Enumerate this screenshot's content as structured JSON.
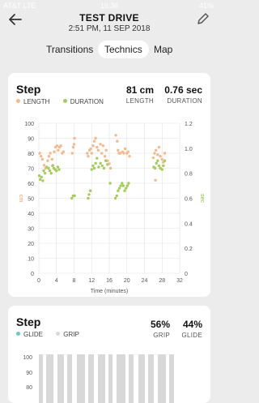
{
  "status": {
    "carrier": "AT&T LTE",
    "time": "16:36",
    "battery": "41%"
  },
  "header": {
    "title": "TEST DRIVE",
    "subtitle": "2:51 PM, 11 SEP 2018"
  },
  "tabs": [
    {
      "label": "Transitions",
      "active": false
    },
    {
      "label": "Technics",
      "active": true
    },
    {
      "label": "Map",
      "active": false
    }
  ],
  "step_card": {
    "title": "Step",
    "legend": [
      {
        "label": "LENGTH",
        "color": "#f5b98d"
      },
      {
        "label": "DURATION",
        "color": "#a6cc5a"
      }
    ],
    "stats": [
      {
        "value": "81 cm",
        "label": "LENGTH"
      },
      {
        "value": "0.76 sec",
        "label": "DURATION"
      }
    ]
  },
  "chart_data": {
    "type": "scatter",
    "xlabel": "Time (minutes)",
    "y_left_label": "cm",
    "y_right_label": "sec",
    "x_ticks": [
      0,
      4,
      8,
      12,
      16,
      20,
      24,
      28,
      32
    ],
    "y_left_ticks": [
      0,
      10,
      20,
      30,
      40,
      50,
      60,
      70,
      80,
      90,
      100
    ],
    "y_right_ticks": [
      "0",
      "0.2",
      "0.4",
      "0.6",
      "0.8",
      "1.0",
      "1.2"
    ],
    "xlim": [
      0,
      32
    ],
    "ylim_left": [
      0,
      100
    ],
    "ylim_right": [
      0,
      1.2
    ],
    "grid": true,
    "series": [
      {
        "name": "LENGTH",
        "axis": "left",
        "color": "#f5b98d",
        "points": [
          [
            0.2,
            80
          ],
          [
            0.5,
            78
          ],
          [
            0.8,
            76
          ],
          [
            1.2,
            72
          ],
          [
            1.5,
            70
          ],
          [
            2,
            75
          ],
          [
            2.3,
            78
          ],
          [
            2.6,
            80
          ],
          [
            3,
            76
          ],
          [
            3.2,
            72
          ],
          [
            3.5,
            81
          ],
          [
            3.8,
            84
          ],
          [
            4.1,
            85
          ],
          [
            4.4,
            82
          ],
          [
            4.7,
            84
          ],
          [
            5,
            85
          ],
          [
            5.3,
            80
          ],
          [
            5.6,
            81
          ],
          [
            7.6,
            80
          ],
          [
            7.8,
            84
          ],
          [
            8,
            86
          ],
          [
            8.1,
            90
          ],
          [
            11,
            80
          ],
          [
            11.2,
            78
          ],
          [
            11.5,
            82
          ],
          [
            11.8,
            83
          ],
          [
            12,
            80
          ],
          [
            12.3,
            85
          ],
          [
            12.6,
            88
          ],
          [
            12.9,
            90
          ],
          [
            13.2,
            84
          ],
          [
            13.5,
            82
          ],
          [
            14,
            86
          ],
          [
            14.3,
            80
          ],
          [
            14.6,
            85
          ],
          [
            15,
            78
          ],
          [
            15.3,
            82
          ],
          [
            15.6,
            75
          ],
          [
            16,
            73
          ],
          [
            16.3,
            70
          ],
          [
            17.5,
            92
          ],
          [
            17.8,
            88
          ],
          [
            18,
            82
          ],
          [
            18.2,
            80
          ],
          [
            18.5,
            80
          ],
          [
            19,
            81
          ],
          [
            19.3,
            80
          ],
          [
            19.6,
            83
          ],
          [
            20,
            80
          ],
          [
            20.3,
            81
          ],
          [
            20.6,
            78
          ],
          [
            26,
            77
          ],
          [
            26.3,
            80
          ],
          [
            26.6,
            82
          ],
          [
            27,
            79
          ],
          [
            27.3,
            84
          ],
          [
            27.6,
            78
          ],
          [
            28,
            76
          ],
          [
            28.3,
            74
          ],
          [
            28.6,
            80
          ],
          [
            26.5,
            62
          ]
        ]
      },
      {
        "name": "DURATION",
        "axis": "right",
        "color": "#a6cc5a",
        "points": [
          [
            0.1,
            0.78
          ],
          [
            0.3,
            0.75
          ],
          [
            0.6,
            0.77
          ],
          [
            0.9,
            0.74
          ],
          [
            1.1,
            0.82
          ],
          [
            1.4,
            0.8
          ],
          [
            1.8,
            0.85
          ],
          [
            2.2,
            0.84
          ],
          [
            2.5,
            0.82
          ],
          [
            2.8,
            0.8
          ],
          [
            3.1,
            0.86
          ],
          [
            3.4,
            0.84
          ],
          [
            3.7,
            0.83
          ],
          [
            4,
            0.82
          ],
          [
            4.3,
            0.85
          ],
          [
            4.6,
            0.83
          ],
          [
            7.5,
            0.6
          ],
          [
            7.8,
            0.62
          ],
          [
            8.1,
            0.62
          ],
          [
            11.2,
            0.6
          ],
          [
            11.4,
            0.63
          ],
          [
            11.7,
            0.66
          ],
          [
            12,
            0.83
          ],
          [
            12.3,
            0.86
          ],
          [
            12.6,
            0.84
          ],
          [
            12.9,
            0.88
          ],
          [
            13.2,
            0.92
          ],
          [
            13.6,
            0.85
          ],
          [
            14,
            0.88
          ],
          [
            14.4,
            0.86
          ],
          [
            14.8,
            0.84
          ],
          [
            15.2,
            0.9
          ],
          [
            15.6,
            0.87
          ],
          [
            16.2,
            0.72
          ],
          [
            17.4,
            0.6
          ],
          [
            17.7,
            0.62
          ],
          [
            18,
            0.66
          ],
          [
            18.3,
            0.68
          ],
          [
            18.6,
            0.7
          ],
          [
            18.9,
            0.72
          ],
          [
            19.2,
            0.7
          ],
          [
            19.5,
            0.66
          ],
          [
            19.8,
            0.68
          ],
          [
            20.1,
            0.7
          ],
          [
            20.4,
            0.72
          ],
          [
            26.1,
            0.85
          ],
          [
            26.4,
            0.84
          ],
          [
            26.7,
            0.88
          ],
          [
            27,
            0.9
          ],
          [
            27.3,
            0.86
          ],
          [
            27.6,
            0.84
          ],
          [
            28,
            0.83
          ],
          [
            28.3,
            0.86
          ],
          [
            28.6,
            0.9
          ]
        ]
      }
    ]
  },
  "step_card2": {
    "title": "Step",
    "legend": [
      {
        "label": "GLIDE",
        "color": "#6cc6cf"
      },
      {
        "label": "GRIP",
        "color": "#d8d8d8"
      }
    ],
    "stats": [
      {
        "value": "56%",
        "label": "GRIP"
      },
      {
        "value": "44%",
        "label": "GLIDE"
      }
    ],
    "y_ticks": [
      "100",
      "90",
      "80"
    ]
  }
}
